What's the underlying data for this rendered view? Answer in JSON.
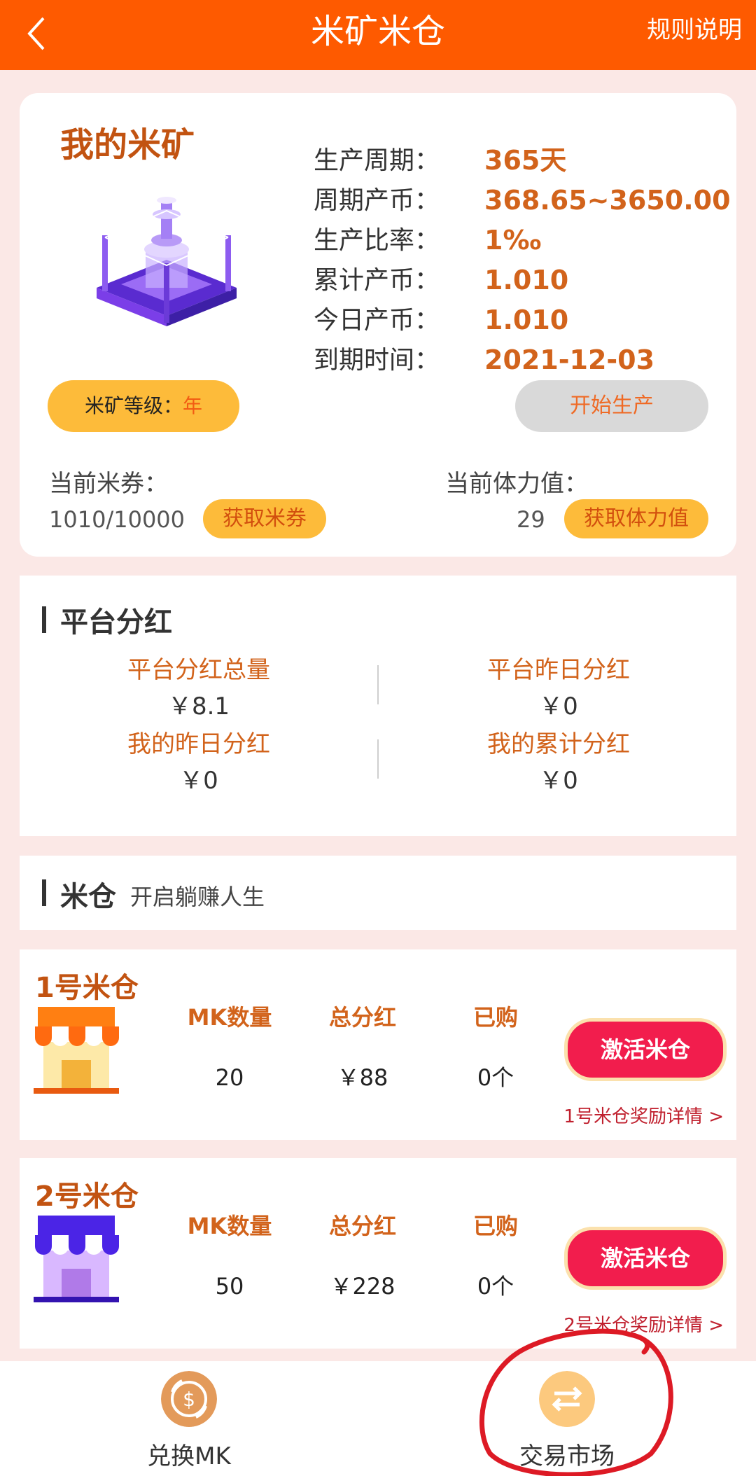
{
  "header": {
    "title": "米矿米仓",
    "rules_label": "规则说明"
  },
  "mine": {
    "title": "我的米矿",
    "stats": [
      {
        "label": "生产周期：",
        "value": "365天"
      },
      {
        "label": "周期产币：",
        "value": "368.65~3650.00"
      },
      {
        "label": "生产比率：",
        "value": "1‰"
      },
      {
        "label": "累计产币：",
        "value": "1.010"
      },
      {
        "label": "今日产币：",
        "value": "1.010"
      },
      {
        "label": "到期时间：",
        "value": "2021-12-03"
      }
    ],
    "level_label": "米矿等级：",
    "level_value": "年",
    "start_label": "开始生产",
    "coupon_label": "当前米券：",
    "coupon_value": "1010/10000",
    "coupon_button": "获取米券",
    "stamina_label": "当前体力值：",
    "stamina_value": "29",
    "stamina_button": "获取体力值"
  },
  "dividend": {
    "title": "平台分红",
    "items": [
      {
        "label": "平台分红总量",
        "value": "￥8.1"
      },
      {
        "label": "平台昨日分红",
        "value": "￥0"
      },
      {
        "label": "我的昨日分红",
        "value": "￥0"
      },
      {
        "label": "我的累计分红",
        "value": "￥0"
      }
    ]
  },
  "granary": {
    "title": "米仓",
    "subtitle": "开启躺赚人生",
    "columns": [
      "MK数量",
      "总分红",
      "已购"
    ],
    "items": [
      {
        "name": "1号米仓",
        "mk": "20",
        "total": "￥88",
        "bought": "0个",
        "button": "激活米仓",
        "detail": "1号米仓奖励详情 >",
        "color": "#fe7a14"
      },
      {
        "name": "2号米仓",
        "mk": "50",
        "total": "￥228",
        "bought": "0个",
        "button": "激活米仓",
        "detail": "2号米仓奖励详情 >",
        "color": "#4b24e6"
      }
    ]
  },
  "nav": {
    "items": [
      {
        "label": "兑换MK",
        "icon": "exchange-coin-icon"
      },
      {
        "label": "交易市场",
        "icon": "trade-arrows-icon"
      }
    ]
  },
  "colors": {
    "header": "#fe5a00",
    "accent": "#d2631b",
    "button": "#fdbb3a",
    "activate": "#f21d4d",
    "annotation": "#dd1a25"
  }
}
